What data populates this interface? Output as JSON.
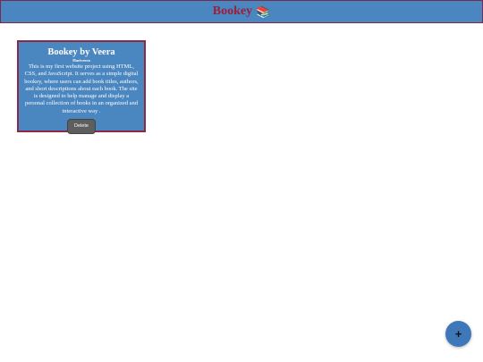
{
  "header": {
    "title": "Bookey",
    "icon": "books-icon",
    "icon_glyph": "📚",
    "bg_color": "#4a86c0",
    "title_color": "#9e1d3a"
  },
  "books": [
    {
      "title": "Bookey by Veera",
      "author": "Hariveera",
      "description": "This is my first website project using HTML, CSS, and JavaScript. It serves as a simple digital bookey, where users can add book titles, authors, and short descriptions about each book. The site is designed to help manage and display a personal collection of books in an organized and interactive way .",
      "delete_label": "Delete"
    }
  ],
  "add_button": {
    "label": "+",
    "icon": "plus-icon"
  }
}
